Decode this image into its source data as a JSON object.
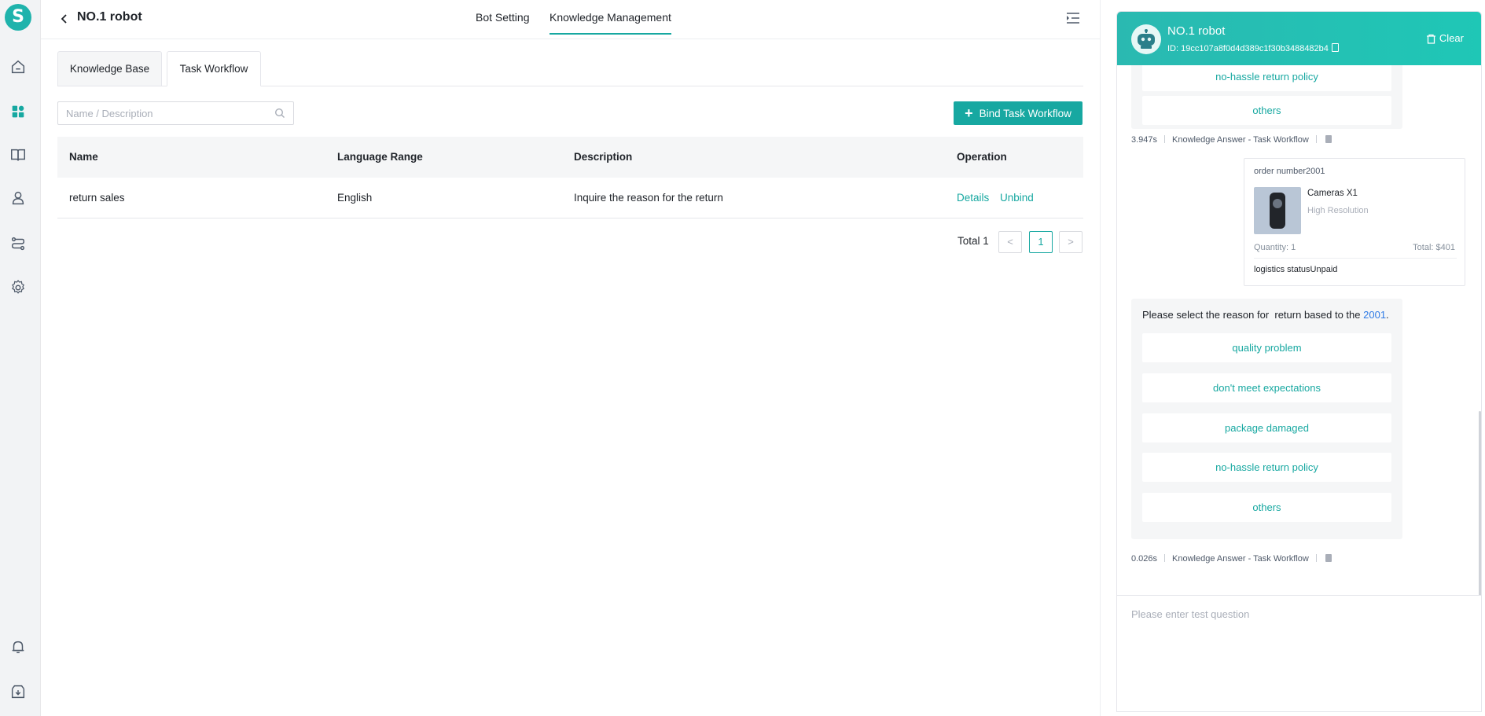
{
  "app": {
    "logo_letter": "S"
  },
  "rail": {
    "items": [
      {
        "icon": "home-icon"
      },
      {
        "icon": "dashboard-icon"
      },
      {
        "icon": "book-icon"
      },
      {
        "icon": "bot-icon"
      },
      {
        "icon": "workflow-icon"
      },
      {
        "icon": "gear-icon"
      },
      {
        "icon": "bell-icon"
      },
      {
        "icon": "download-icon"
      }
    ]
  },
  "header": {
    "title": "NO.1 robot",
    "tabs": [
      {
        "label": "Bot Setting",
        "active": false
      },
      {
        "label": "Knowledge Management",
        "active": true
      }
    ]
  },
  "subtabs": [
    {
      "label": "Knowledge Base",
      "active": false
    },
    {
      "label": "Task Workflow",
      "active": true
    }
  ],
  "search": {
    "placeholder": "Name / Description",
    "value": ""
  },
  "bind_button": {
    "label": "Bind Task Workflow"
  },
  "table": {
    "columns": [
      "Name",
      "Language Range",
      "Description",
      "Operation"
    ],
    "rows": [
      {
        "name": "return sales",
        "language": "English",
        "description": "Inquire the reason for the return",
        "actions": [
          "Details",
          "Unbind"
        ]
      }
    ]
  },
  "pagination": {
    "total_label": "Total 1",
    "current_page": "1",
    "prev": "<",
    "next": ">"
  },
  "chat": {
    "bot_name": "NO.1 robot",
    "bot_id": "ID: 19cc107a8f0d4d389c1f30b3488482b4",
    "clear_label": "Clear",
    "messages": {
      "first_options_visible": [
        "no-hassle return policy",
        "others"
      ],
      "first_meta": {
        "time": "3.947s",
        "source": "Knowledge Answer - Task Workflow"
      },
      "order_card": {
        "order_number": "order number2001",
        "product_name": "Cameras X1",
        "product_sub": "High Resolution",
        "quantity": "Quantity: 1",
        "total": "Total: $401",
        "logistics": "logistics statusUnpaid"
      },
      "prompt": {
        "text_before": "Please select the reason for  return based to the ",
        "order_ref": "2001",
        "text_after": "."
      },
      "second_options": [
        "quality problem",
        "don't meet expectations",
        "package damaged",
        "no-hassle return policy",
        "others"
      ],
      "second_meta": {
        "time": "0.026s",
        "source": "Knowledge Answer - Task Workflow"
      }
    },
    "input_placeholder": "Please enter test question"
  },
  "colors": {
    "accent": "#17a8a1",
    "link_blue": "#2f7be6"
  }
}
